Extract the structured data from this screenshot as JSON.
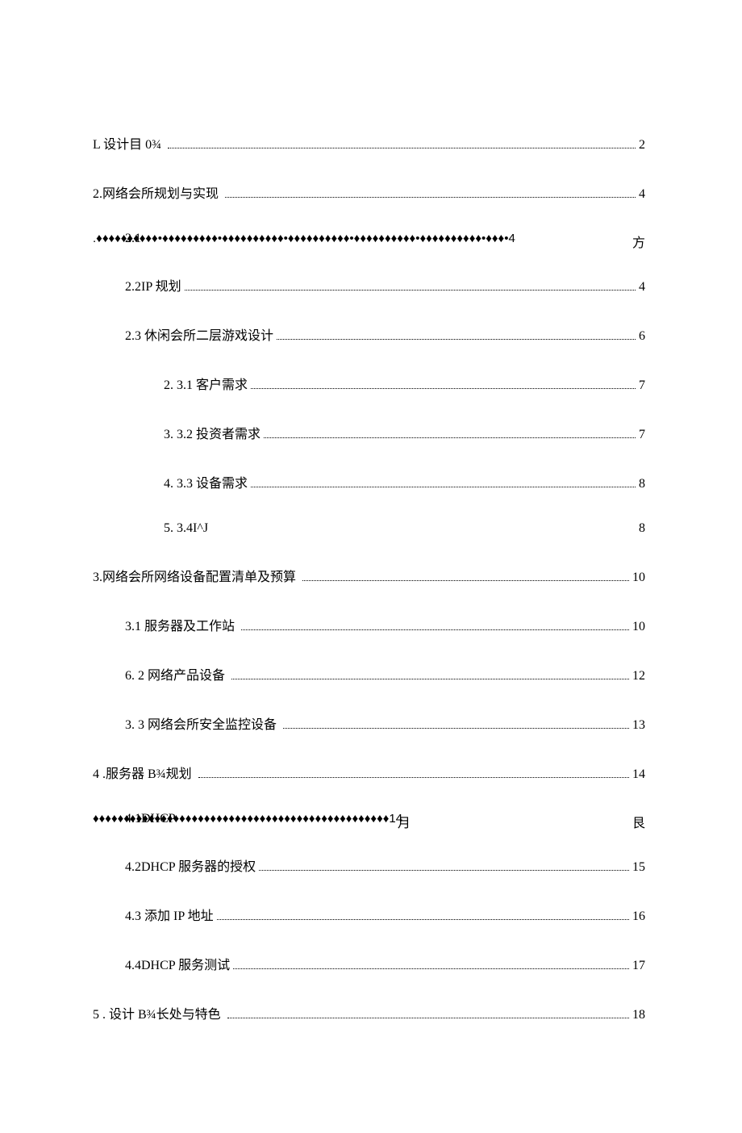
{
  "toc": {
    "e1_label": "L 设计目 0¾",
    "e1_page": "2",
    "e2_label": "2.网络会所规划与实现",
    "e2_page": "4",
    "e3_left": "2.1",
    "e3_right": "方",
    "e3_diamonds": ".♦♦♦♦♦♦♦♦♦♦•♦♦♦♦♦♦♦♦♦•♦♦♦♦♦♦♦♦♦♦•♦♦♦♦♦♦♦♦♦♦•♦♦♦♦♦♦♦♦♦♦•♦♦♦♦♦♦♦♦♦♦•♦♦♦•4",
    "e4_label": "2.2IP 规划",
    "e4_page": "4",
    "e5_label": "2.3 休闲会所二层游戏设计",
    "e5_page": "6",
    "e6_label": "2.  3.1 客户需求",
    "e6_page": "7",
    "e7_label": "3.  3.2 投资者需求",
    "e7_page": "7",
    "e8_label": "4.  3.3 设备需求",
    "e8_page": "8",
    "e9_label": "5.  3.4I^J",
    "e9_page": "8",
    "e10_label": "3.网络会所网络设备配置清单及预算",
    "e10_page": "10",
    "e11_label": "3.1   服务器及工作站",
    "e11_page": "10",
    "e12_label": "6.  2 网络产品设备",
    "e12_page": "12",
    "e13_label": "3.  3 网络会所安全监控设备",
    "e13_page": "13",
    "e14_label": "4  .服务器 B¾规划",
    "e14_page": "14",
    "e15_left": "4.1DHCP",
    "e15_mid": "月",
    "e15_right": "艮",
    "e15_diamonds": "♦♦♦♦♦♦♦♦♦♦♦♦♦♦♦♦♦♦♦♦♦♦♦♦♦♦♦♦♦♦♦♦♦♦♦♦♦♦♦♦♦♦♦♦♦♦♦♦14",
    "e16_label": "4.2DHCP 服务器的授权",
    "e16_page": "15",
    "e17_label": "4.3 添加 IP 地址",
    "e17_page": "16",
    "e18_label": "4.4DHCP 服务测试",
    "e18_page": "17",
    "e19_label": "5  . 设计 B¾长处与特色",
    "e19_page": "18"
  }
}
